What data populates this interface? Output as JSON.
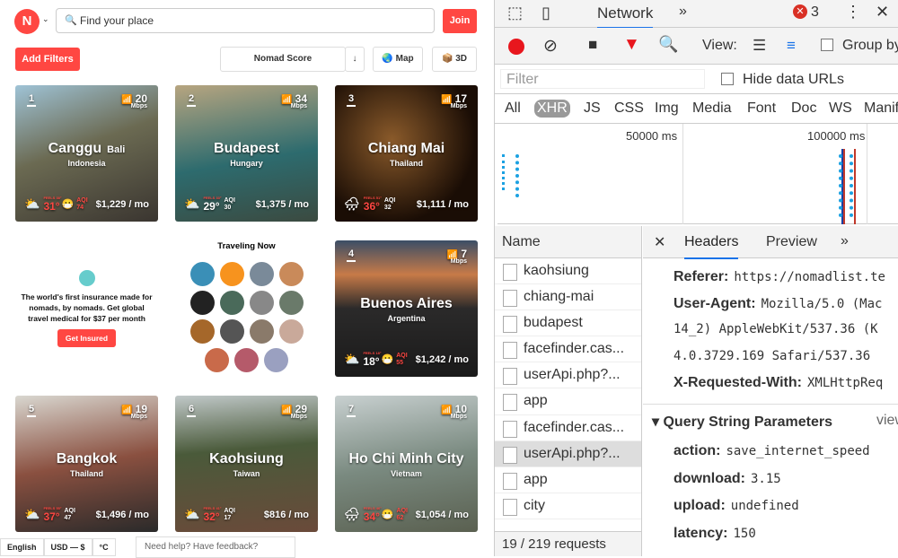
{
  "topbar": {
    "search_placeholder": "Find your place",
    "join": "Join",
    "add_filters": "Add Filters",
    "sort": "Nomad Score",
    "sort_dir": "↓",
    "map": "Map",
    "threed": "3D"
  },
  "cards": [
    {
      "rank": "1",
      "speed": "20",
      "unit": "Mbps",
      "city": "Canggu",
      "region": "Bali",
      "country": "Indonesia",
      "feels": "FEELS 38°",
      "temp": "31°",
      "aqi": "74",
      "cost": "$1,229 / mo",
      "weather": "cloudy",
      "hot": true,
      "badaqi": true
    },
    {
      "rank": "2",
      "speed": "34",
      "unit": "Mbps",
      "city": "Budapest",
      "region": "",
      "country": "Hungary",
      "feels": "FEELS 33°",
      "temp": "29°",
      "aqi": "30",
      "cost": "$1,375 / mo",
      "weather": "cloudy",
      "hot": false,
      "badaqi": false
    },
    {
      "rank": "3",
      "speed": "17",
      "unit": "Mbps",
      "city": "Chiang Mai",
      "region": "",
      "country": "Thailand",
      "feels": "FEELS 51°",
      "temp": "36°",
      "aqi": "32",
      "cost": "$1,111 / mo",
      "weather": "rain",
      "hot": true,
      "badaqi": false
    },
    {
      "rank": "4",
      "speed": "7",
      "unit": "Mbps",
      "city": "Buenos Aires",
      "region": "",
      "country": "Argentina",
      "feels": "FEELS 18°",
      "temp": "18°",
      "aqi": "55",
      "cost": "$1,242 / mo",
      "weather": "cloudy",
      "hot": false,
      "badaqi": true
    },
    {
      "rank": "5",
      "speed": "19",
      "unit": "Mbps",
      "city": "Bangkok",
      "region": "",
      "country": "Thailand",
      "feels": "FEELS 55°",
      "temp": "37°",
      "aqi": "47",
      "cost": "$1,496 / mo",
      "weather": "cloudy",
      "hot": true,
      "badaqi": false
    },
    {
      "rank": "6",
      "speed": "29",
      "unit": "Mbps",
      "city": "Kaohsiung",
      "region": "",
      "country": "Taiwan",
      "feels": "FEELS 41°",
      "temp": "32°",
      "aqi": "17",
      "cost": "$816 / mo",
      "weather": "cloudy",
      "hot": true,
      "badaqi": false
    },
    {
      "rank": "7",
      "speed": "10",
      "unit": "Mbps",
      "city": "Ho Chi Minh City",
      "region": "",
      "country": "Vietnam",
      "feels": "FEELS 46°",
      "temp": "34°",
      "aqi": "62",
      "cost": "$1,054 / mo",
      "weather": "rain",
      "hot": true,
      "badaqi": true
    }
  ],
  "aqi_label": "AQI",
  "insurance": {
    "text": "The world's first insurance made for nomads, by nomads. Get global travel medical for $37 per month",
    "button": "Get Insured"
  },
  "traveling": {
    "title": "Traveling Now",
    "avatar_colors": [
      "#3a8fb7",
      "#f7931e",
      "#7a8a99",
      "#c98a5a",
      "#222",
      "#4a6a5a",
      "#888",
      "#6a7a6a",
      "#a5672a",
      "#555",
      "#8a7a6a",
      "#c9a99a",
      "#c96a4a",
      "#b55a6a",
      "#9aa0c0"
    ]
  },
  "footer": {
    "lang": "English",
    "currency": "USD — $",
    "unit": "°C",
    "help": "Need help? Have feedback?"
  },
  "devtools": {
    "tab": "Network",
    "more": "»",
    "errors": "3",
    "view": "View:",
    "group": "Group by frame",
    "filter_placeholder": "Filter",
    "hide_data": "Hide data URLs",
    "types": [
      "All",
      "XHR",
      "JS",
      "CSS",
      "Img",
      "Media",
      "Font",
      "Doc",
      "WS",
      "Manifest"
    ],
    "timeline": [
      "50000 ms",
      "100000 ms"
    ],
    "name_header": "Name",
    "requests": [
      "kaohsiung",
      "chiang-mai",
      "budapest",
      "facefinder.cas...",
      "userApi.php?...",
      "app",
      "facefinder.cas...",
      "userApi.php?...",
      "app",
      "city"
    ],
    "selected_index": 7,
    "status": "19 / 219 requests",
    "panel_tabs": [
      "Headers",
      "Preview"
    ],
    "headers": [
      {
        "k": "Referer:",
        "v": "https://nomadlist.te"
      },
      {
        "k": "User-Agent:",
        "v": "Mozilla/5.0 (Mac"
      },
      {
        "k": "",
        "v": "14_2) AppleWebKit/537.36 (K"
      },
      {
        "k": "",
        "v": "4.0.3729.169 Safari/537.36"
      },
      {
        "k": "X-Requested-With:",
        "v": "XMLHttpReq"
      }
    ],
    "qs_title": "Query String Parameters",
    "qs_view": "view",
    "params": [
      {
        "k": "action:",
        "v": "save_internet_speed"
      },
      {
        "k": "download:",
        "v": "3.15"
      },
      {
        "k": "upload:",
        "v": "undefined"
      },
      {
        "k": "latency:",
        "v": "150"
      }
    ]
  }
}
